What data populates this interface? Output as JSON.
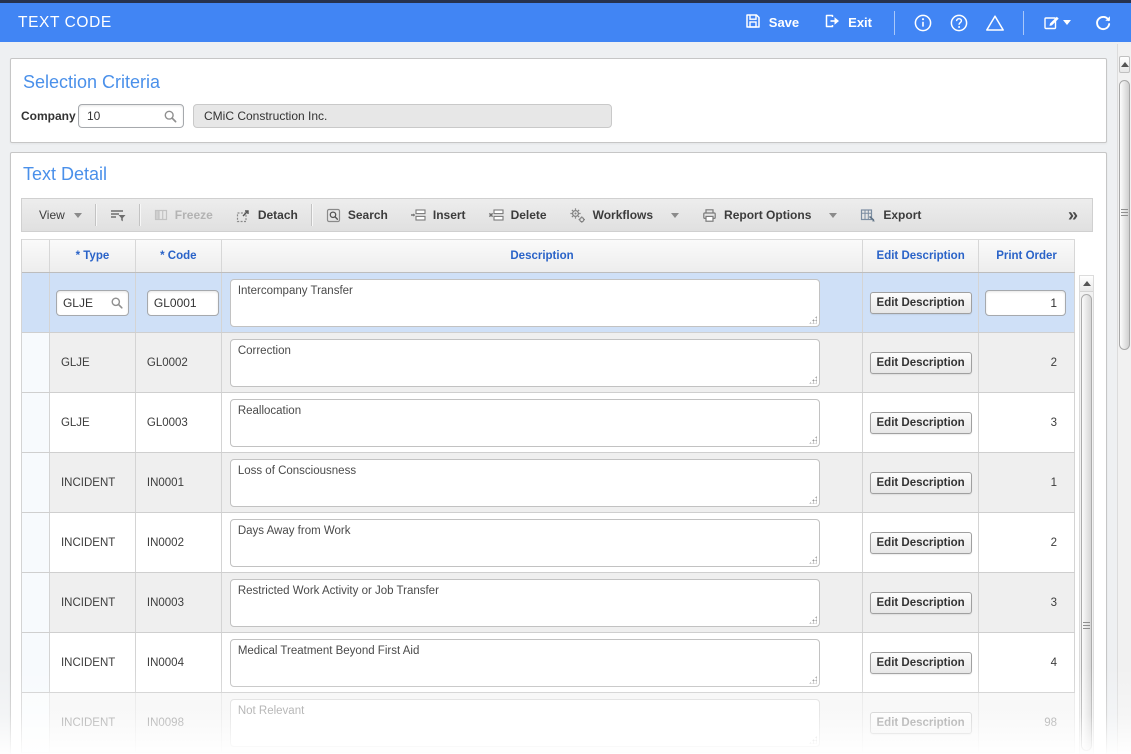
{
  "header": {
    "title": "TEXT CODE",
    "save_label": "Save",
    "exit_label": "Exit"
  },
  "icons": {
    "save": "floppy-disk",
    "exit": "door-arrow-right",
    "info": "circle-i",
    "help": "circle-question",
    "warning": "triangle-alert",
    "edit": "pencil-square",
    "refresh": "circular-arrow",
    "lookup": "magnifier"
  },
  "colors": {
    "topbar_blue": "#4185f4",
    "top_strip": "#26324e",
    "section_title_blue": "#4a90ea",
    "grid_header_blue": "#2a63c8",
    "selected_row": "#cfe0f7",
    "stripe_row": "#efefef",
    "readonly_field": "#e7e7e7"
  },
  "selection_criteria": {
    "title": "Selection Criteria",
    "company_label": "Company",
    "company_value": "10",
    "company_name": "CMiC Construction Inc."
  },
  "text_detail": {
    "title": "Text Detail",
    "toolbar": {
      "view": "View",
      "freeze": "Freeze",
      "detach": "Detach",
      "search": "Search",
      "insert": "Insert",
      "delete": "Delete",
      "workflows": "Workflows",
      "report_options": "Report Options",
      "export": "Export",
      "overflow": "»"
    },
    "table": {
      "columns": [
        "",
        "* Type",
        "* Code",
        "Description",
        "Edit Description",
        "Print Order"
      ],
      "edit_button_label": "Edit Description",
      "rows": [
        {
          "type": "GLJE",
          "code": "GL0001",
          "description": "Intercompany Transfer",
          "print_order": "1",
          "selected": true
        },
        {
          "type": "GLJE",
          "code": "GL0002",
          "description": "Correction",
          "print_order": "2"
        },
        {
          "type": "GLJE",
          "code": "GL0003",
          "description": "Reallocation",
          "print_order": "3"
        },
        {
          "type": "INCIDENT",
          "code": "IN0001",
          "description": "Loss of Consciousness",
          "print_order": "1"
        },
        {
          "type": "INCIDENT",
          "code": "IN0002",
          "description": "Days Away from Work",
          "print_order": "2"
        },
        {
          "type": "INCIDENT",
          "code": "IN0003",
          "description": "Restricted Work Activity or Job Transfer",
          "print_order": "3"
        },
        {
          "type": "INCIDENT",
          "code": "IN0004",
          "description": "Medical Treatment Beyond First Aid",
          "print_order": "4"
        },
        {
          "type": "INCIDENT",
          "code": "IN0098",
          "description": "Not Relevant",
          "print_order": "98",
          "faded": true
        }
      ]
    }
  }
}
